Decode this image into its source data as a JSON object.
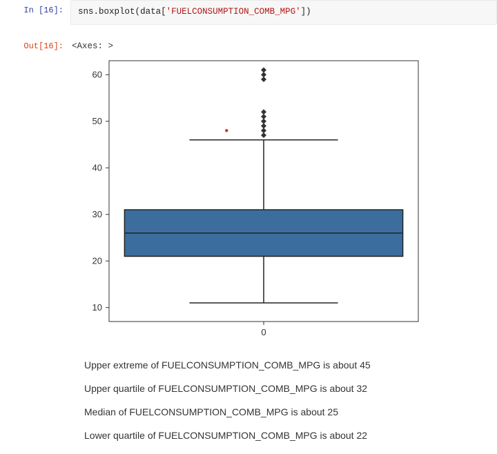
{
  "cell": {
    "in_prompt": "In [16]:",
    "out_prompt": "Out[16]:",
    "code_pre": "sns",
    "code_dot1": ".",
    "code_fn": "boxplot",
    "code_open": "(",
    "code_arg1": "data",
    "code_bracket_open": "[",
    "code_str": "'FUELCONSUMPTION_COMB_MPG'",
    "code_bracket_close": "]",
    "code_close": ")",
    "out_text": "<Axes: >"
  },
  "annotations": {
    "line1": "Upper extreme of FUELCONSUMPTION_COMB_MPG is about 45",
    "line2": "Upper quartile of FUELCONSUMPTION_COMB_MPG is about 32",
    "line3": "Median of FUELCONSUMPTION_COMB_MPG is about 25",
    "line4": "Lower quartile of FUELCONSUMPTION_COMB_MPG is about 22"
  },
  "chart_data": {
    "type": "boxplot",
    "category_label": "0",
    "ylim": [
      7,
      63
    ],
    "yticks": [
      10,
      20,
      30,
      40,
      50,
      60
    ],
    "box": {
      "q1": 21,
      "median": 26,
      "q3": 31
    },
    "whisker_low": 11,
    "whisker_high": 46,
    "outliers": [
      47,
      48,
      49,
      50,
      51,
      52,
      59,
      60,
      61
    ],
    "extra_point": {
      "x_offset": -0.06,
      "y": 48,
      "color": "#c0392b"
    },
    "box_color": "#3b6e9f",
    "line_color": "#222222"
  }
}
